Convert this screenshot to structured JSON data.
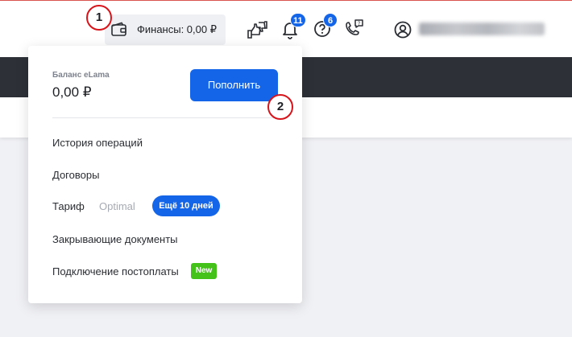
{
  "header": {
    "finance_button_label": "Финансы: 0,00 ₽",
    "notifications_count": "11",
    "help_count": "6",
    "icons": [
      "wallet-icon",
      "thumbs-feedback-icon",
      "bell-icon",
      "help-icon",
      "phone-support-icon",
      "user-icon"
    ],
    "user_name_blurred": true
  },
  "dropdown": {
    "balance_label": "Баланс eLama",
    "balance_value": "0,00 ₽",
    "topup_label": "Пополнить",
    "items": [
      {
        "label": "История операций"
      },
      {
        "label": "Договоры"
      },
      {
        "label": "Закрывающие документы"
      },
      {
        "label": "Подключение постоплаты"
      }
    ],
    "tariff": {
      "label": "Тариф",
      "value": "Optimal",
      "badge": "Ещё 10 дней"
    },
    "new_badge": "New"
  },
  "markers": [
    "1",
    "2"
  ],
  "colors": {
    "accent": "#1565e8",
    "new_badge": "#45c21a",
    "marker_border": "#d8141b",
    "dark_band": "#2e3038",
    "background": "#f0f1f5"
  }
}
